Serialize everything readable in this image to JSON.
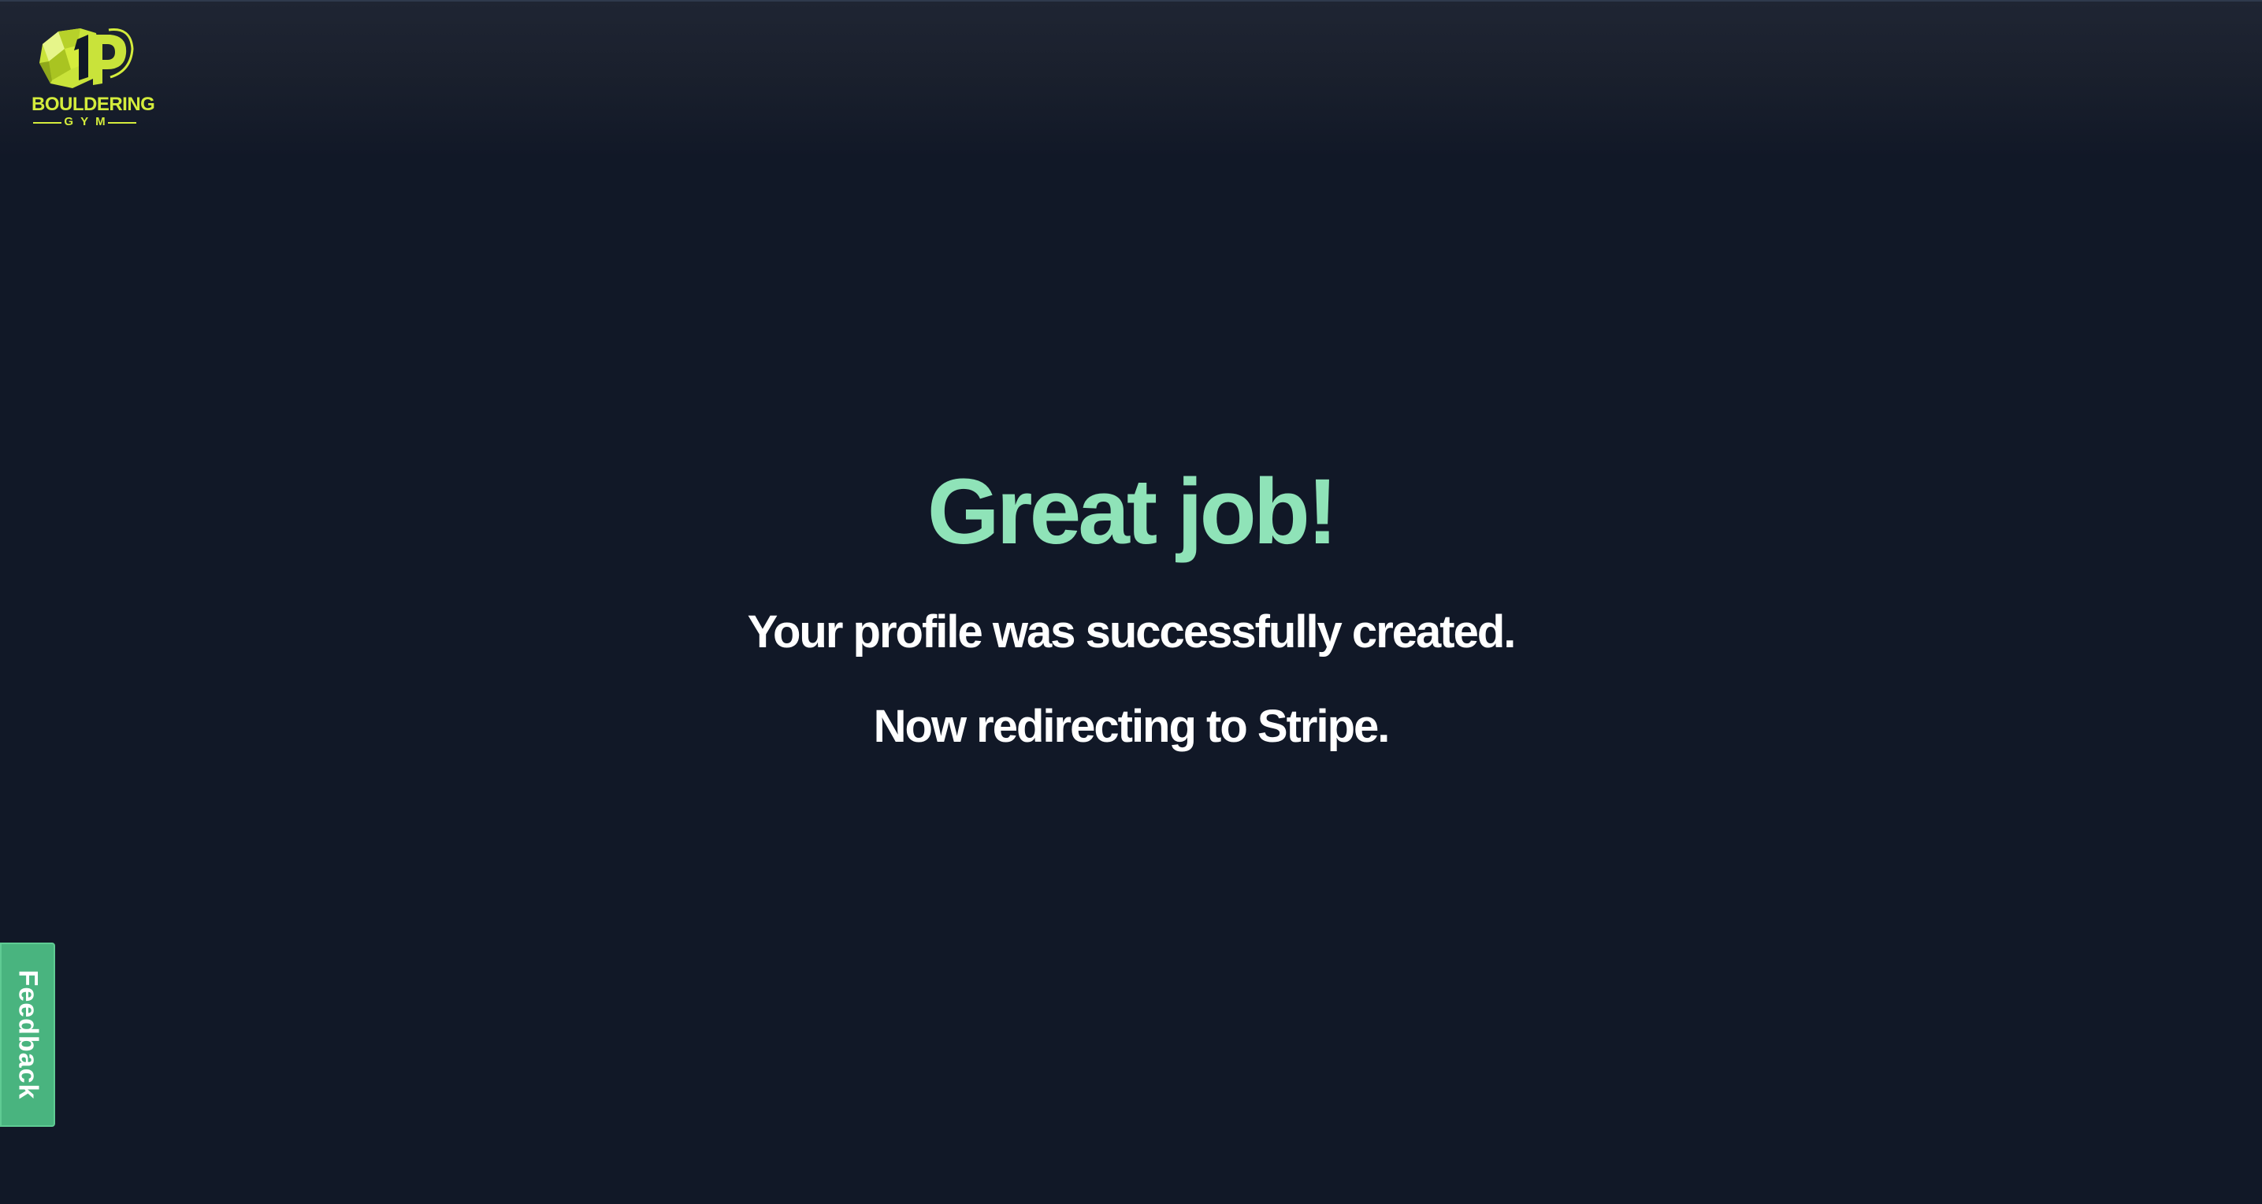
{
  "brand": {
    "name": "BOULDERING",
    "sub": "GYM",
    "logo_icon": "bouldering-gym-logo-icon",
    "accent_color": "#d4ec3c"
  },
  "main": {
    "headline": "Great job!",
    "message_line1": "Your profile was successfully created.",
    "message_line2": "Now redirecting to Stripe.",
    "headline_color": "#8fe3b8"
  },
  "feedback": {
    "label": "Feedback",
    "color": "#49b47f"
  },
  "theme": {
    "background": "#111827"
  }
}
